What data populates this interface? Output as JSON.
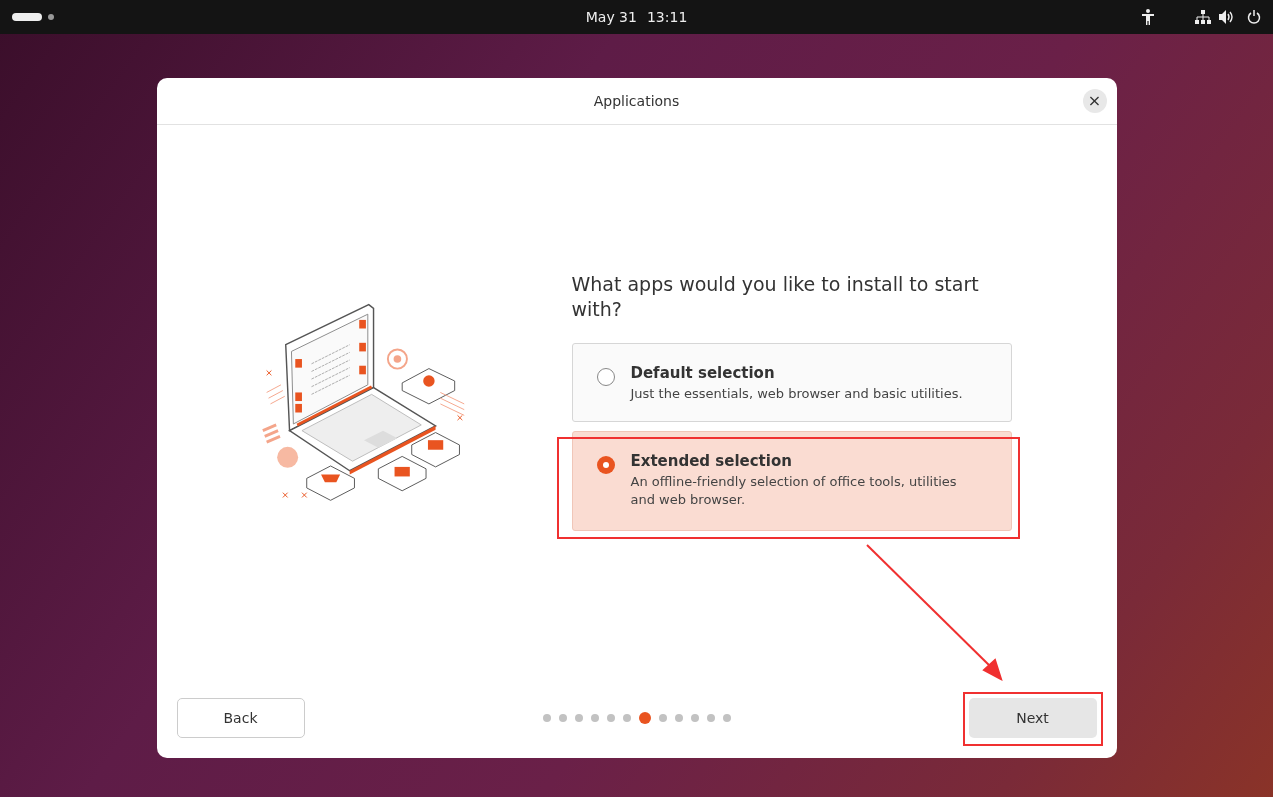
{
  "top_bar": {
    "date": "May 31",
    "time": "13:11"
  },
  "dialog": {
    "title": "Applications",
    "close": "×"
  },
  "question": "What apps would you like to install to start with?",
  "options": [
    {
      "title": "Default selection",
      "description": "Just the essentials, web browser and basic utilities.",
      "selected": false
    },
    {
      "title": "Extended selection",
      "description": "An offline-friendly selection of office tools, utilities and web browser.",
      "selected": true
    }
  ],
  "pages": [
    {
      "selected": false
    },
    {
      "selected": false
    },
    {
      "selected": false
    },
    {
      "selected": false
    },
    {
      "selected": false
    },
    {
      "selected": false
    },
    {
      "selected": true
    },
    {
      "selected": false
    },
    {
      "selected": false
    },
    {
      "selected": false
    },
    {
      "selected": false
    },
    {
      "selected": false
    }
  ],
  "buttons": {
    "back": "Back",
    "next": "Next"
  },
  "annotations": [
    {
      "kind": "box-option"
    },
    {
      "kind": "box-next"
    },
    {
      "kind": "arrow"
    }
  ]
}
